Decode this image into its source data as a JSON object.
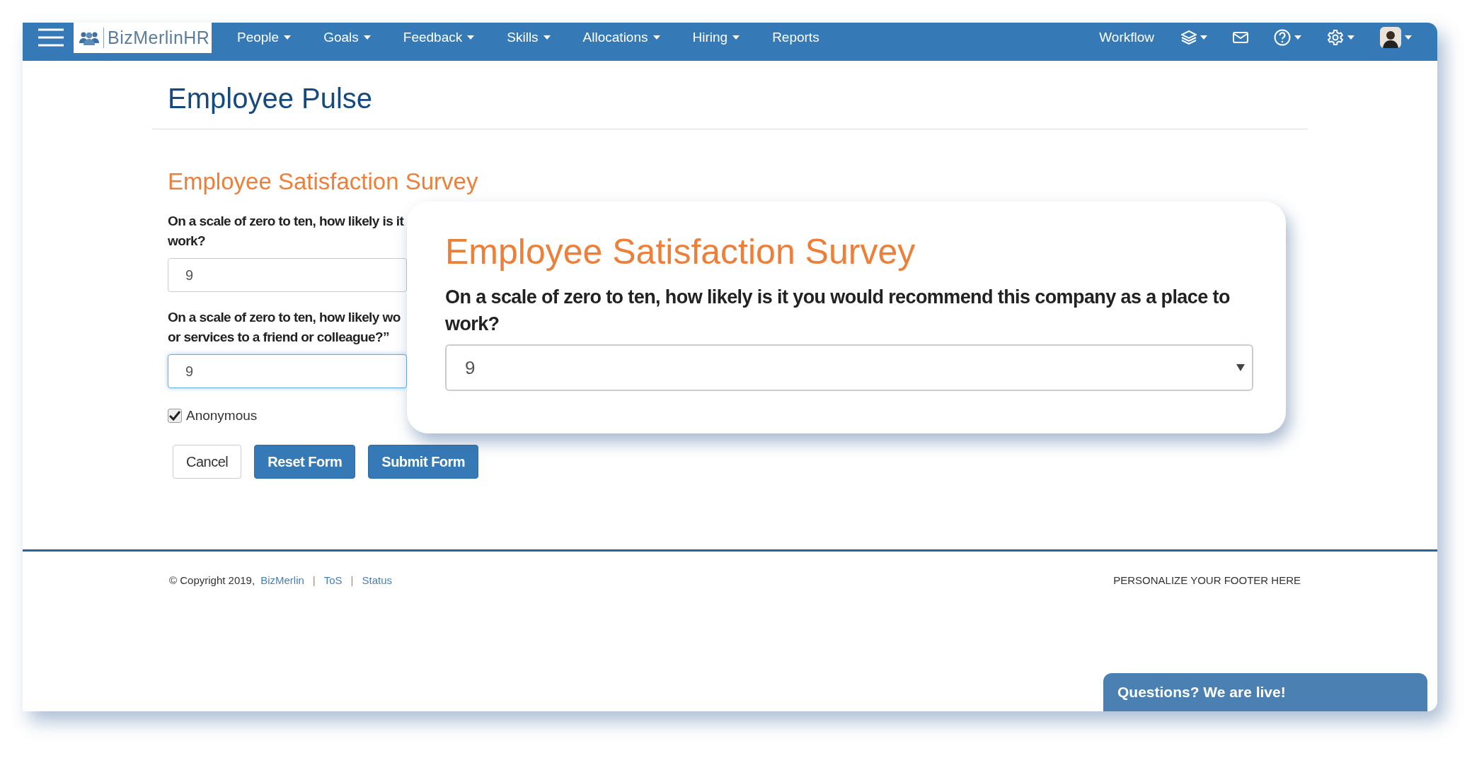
{
  "navbar": {
    "brand": "BizMerlinHR",
    "menu": [
      {
        "label": "People",
        "dropdown": true
      },
      {
        "label": "Goals",
        "dropdown": true
      },
      {
        "label": "Feedback",
        "dropdown": true
      },
      {
        "label": "Skills",
        "dropdown": true
      },
      {
        "label": "Allocations",
        "dropdown": true
      },
      {
        "label": "Hiring",
        "dropdown": true
      },
      {
        "label": "Reports",
        "dropdown": false
      }
    ],
    "workflow": "Workflow",
    "icons": [
      {
        "kind": "layers",
        "dropdown": true
      },
      {
        "kind": "mail",
        "dropdown": false
      },
      {
        "kind": "help",
        "dropdown": true
      },
      {
        "kind": "settings",
        "dropdown": true
      },
      {
        "kind": "avatar",
        "dropdown": true
      }
    ]
  },
  "page_title": "Employee Pulse",
  "form": {
    "title": "Employee Satisfaction Survey",
    "questions": [
      {
        "lines": [
          "On a scale of zero to ten, how likely is it",
          "work?"
        ],
        "value": "9",
        "focused": false
      },
      {
        "lines": [
          "On a scale of zero to ten, how likely wo",
          "or services to a friend or colleague?”"
        ],
        "value": "9",
        "focused": true
      }
    ],
    "anonymous": {
      "label": "Anonymous",
      "checked": true
    },
    "buttons": [
      {
        "label": "Cancel",
        "kind": "default"
      },
      {
        "label": "Reset Form",
        "kind": "primary"
      },
      {
        "label": "Submit Form",
        "kind": "primary"
      }
    ]
  },
  "zoom_card": {
    "title": "Employee Satisfaction Survey",
    "question": "On a scale of zero to ten, how likely is it you would recommend this company as a place to work?",
    "value": "9"
  },
  "footer": {
    "items": [
      {
        "kind": "text",
        "text": "© Copyright 2019,"
      },
      {
        "kind": "link",
        "text": "BizMerlin"
      },
      {
        "kind": "separator",
        "text": "|"
      },
      {
        "kind": "link",
        "text": "ToS"
      },
      {
        "kind": "separator",
        "text": "|"
      },
      {
        "kind": "link",
        "text": "Status"
      }
    ],
    "right": "PERSONALIZE YOUR FOOTER HERE"
  },
  "chat": {
    "label": "Questions? We are live!"
  }
}
